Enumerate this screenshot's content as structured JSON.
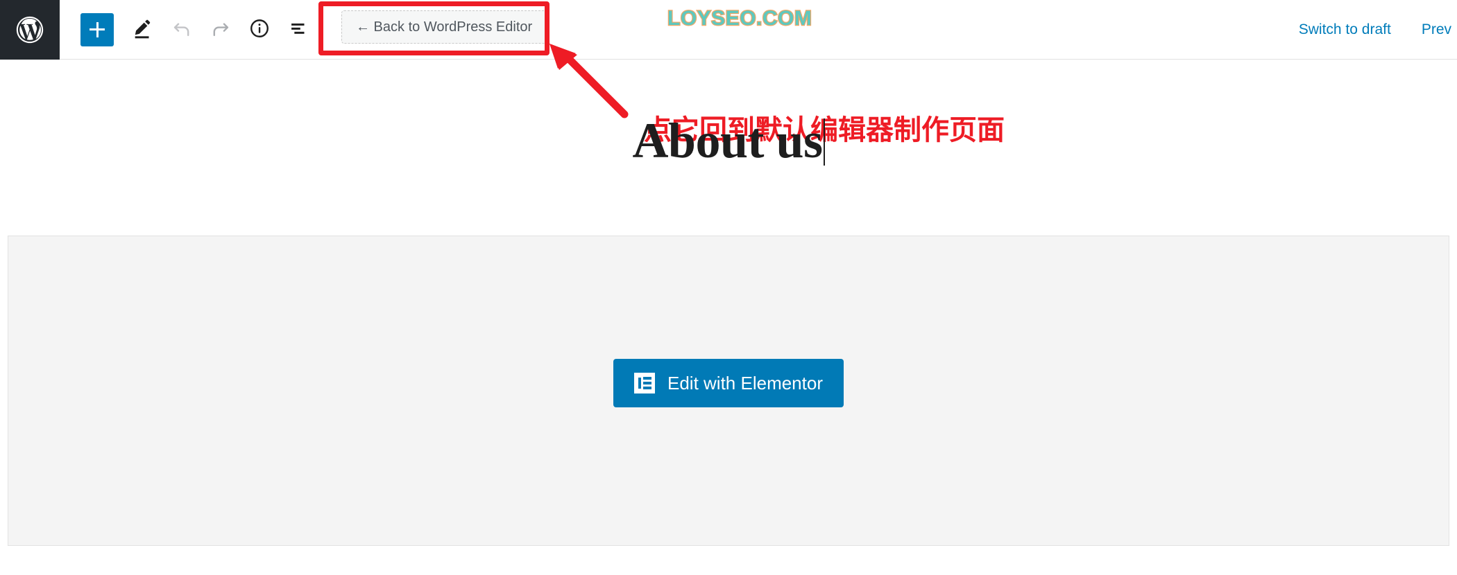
{
  "window": {
    "background": "#ffffff"
  },
  "editor_bar": {
    "wp_logo": {
      "icon": "wordpress-logo-icon",
      "background": "#23282d",
      "color": "#ffffff"
    },
    "tools": [
      {
        "icon": "plus-icon",
        "name": "add-block-button",
        "label": "+",
        "active": true,
        "accent": "#007cba"
      },
      {
        "icon": "pencil-icon",
        "name": "edit-mode-button",
        "label": "Edit",
        "active": false,
        "accent": "#1e1e1e"
      },
      {
        "icon": "undo-arrow-icon",
        "name": "undo-button",
        "label": "Undo",
        "active": false,
        "accent": "#c3c4c7"
      },
      {
        "icon": "redo-arrow-icon",
        "name": "redo-button",
        "label": "Redo",
        "active": false,
        "accent": "#a7aaad"
      },
      {
        "icon": "info-circle-icon",
        "name": "details-button",
        "label": "Details",
        "active": false,
        "accent": "#1e1e1e"
      },
      {
        "icon": "list-view-icon",
        "name": "list-view-button",
        "label": "List view",
        "active": false,
        "accent": "#1e1e1e"
      }
    ],
    "back_button": {
      "label": "← Back to WordPress Editor",
      "text_color": "#50575e",
      "background": "#f6f7f7"
    },
    "site_logo": {
      "text": "LOYSEO.COM",
      "fill_color": "#5ec8bf",
      "outline_color": "#f0a868"
    },
    "right_actions": [
      {
        "label": "Switch to draft",
        "name": "switch-to-draft-button",
        "color": "#007cba"
      },
      {
        "label": "Prev",
        "name": "preview-button",
        "color": "#007cba"
      }
    ]
  },
  "annotation": {
    "highlight_color": "#ee1c25",
    "text": "点它回到默认编辑器制作页面",
    "arrow": "red-arrow-icon"
  },
  "post": {
    "title": "About us",
    "caret_visible": true
  },
  "content": {
    "panel_background": "#f4f4f4",
    "elementor_button": {
      "label": "Edit with Elementor",
      "icon": "elementor-icon",
      "background": "#017ab6",
      "text_color": "#ffffff"
    }
  }
}
